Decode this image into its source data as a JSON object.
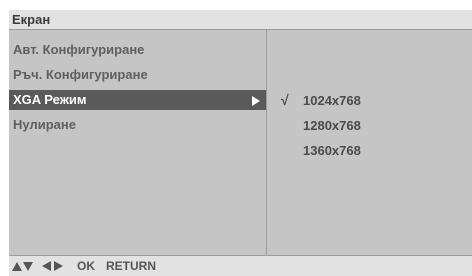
{
  "menu": {
    "title": "Екран",
    "items": [
      {
        "label": "Авт. Конфигуриране"
      },
      {
        "label": "Ръч. Конфигуриране"
      },
      {
        "label": "XGA Режим",
        "selected": true
      },
      {
        "label": "Нулиране"
      }
    ]
  },
  "submenu": {
    "options": [
      {
        "label": "1024x768",
        "checked": true,
        "check_mark": "√"
      },
      {
        "label": "1280x768",
        "checked": false
      },
      {
        "label": "1360x768",
        "checked": false
      }
    ]
  },
  "footer": {
    "nav_icons": [
      "up-arrow-icon",
      "down-arrow-icon",
      "left-arrow-icon",
      "right-arrow-icon"
    ],
    "ok_label": "OK",
    "return_label": "RETURN"
  },
  "colors": {
    "panel_bg": "#c5c5c5",
    "bar_bg": "#e2e2e2",
    "selected_bg": "#5a5a5a",
    "text": "#5f5f5f"
  }
}
